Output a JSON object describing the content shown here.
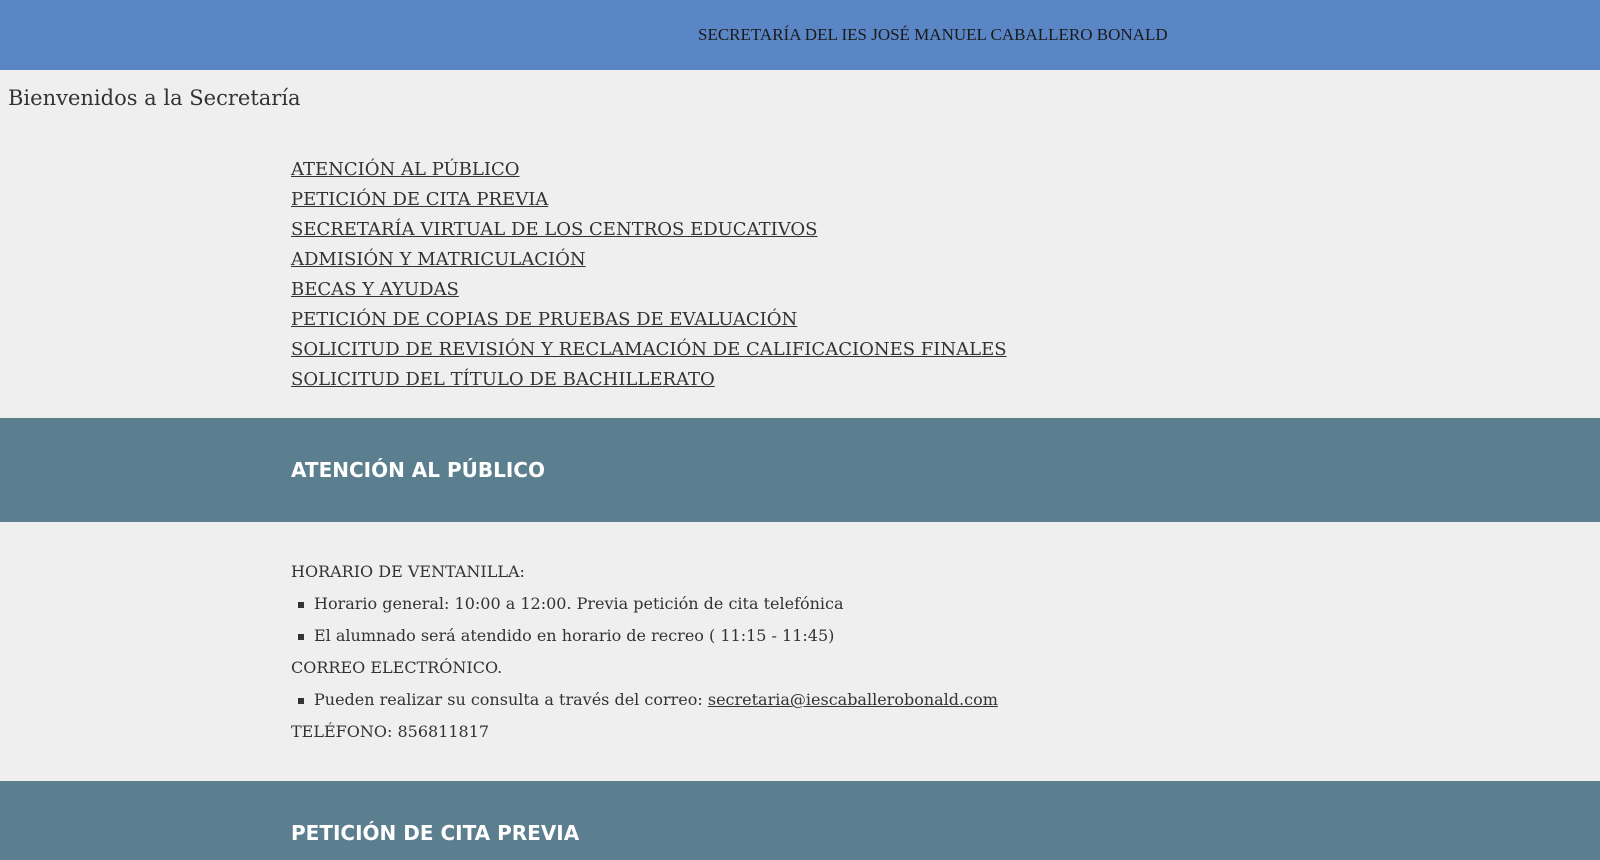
{
  "header": {
    "title": "SECRETARÍA DEL IES JOSÉ MANUEL CABALLERO BONALD"
  },
  "welcome": "Bienvenidos a la Secretaría",
  "nav": {
    "items": [
      {
        "label": "ATENCIÓN AL PÚBLICO"
      },
      {
        "label": "PETICIÓN DE CITA PREVIA"
      },
      {
        "label": "SECRETARÍA VIRTUAL DE LOS CENTROS EDUCATIVOS"
      },
      {
        "label": "ADMISIÓN Y MATRICULACIÓN"
      },
      {
        "label": "BECAS Y AYUDAS"
      },
      {
        "label": "PETICIÓN DE COPIAS DE PRUEBAS DE EVALUACIÓN"
      },
      {
        "label": "SOLICITUD DE REVISIÓN Y RECLAMACIÓN DE CALIFICACIONES FINALES"
      },
      {
        "label": "SOLICITUD DEL TÍTULO DE BACHILLERATO"
      }
    ]
  },
  "sections": {
    "atencion": {
      "heading": "ATENCIÓN AL PÚBLICO",
      "horario_label": "HORARIO DE VENTANILLA:",
      "horario_items": [
        "Horario general: 10:00 a 12:00. Previa petición de cita telefónica",
        "El alumnado será atendido en horario de recreo ( 11:15 - 11:45)"
      ],
      "correo_label": "CORREO ELECTRÓNICO.",
      "correo_text": "Pueden realizar su consulta a través del correo: ",
      "correo_link": "secretaria@iescaballerobonald.com",
      "telefono": "TELÉFONO: 856811817"
    },
    "cita": {
      "heading": "PETICIÓN DE CITA PREVIA"
    }
  },
  "colors": {
    "header_bg": "#5b86c6",
    "section_bg": "#5b7f8e",
    "page_bg": "#efefef"
  }
}
